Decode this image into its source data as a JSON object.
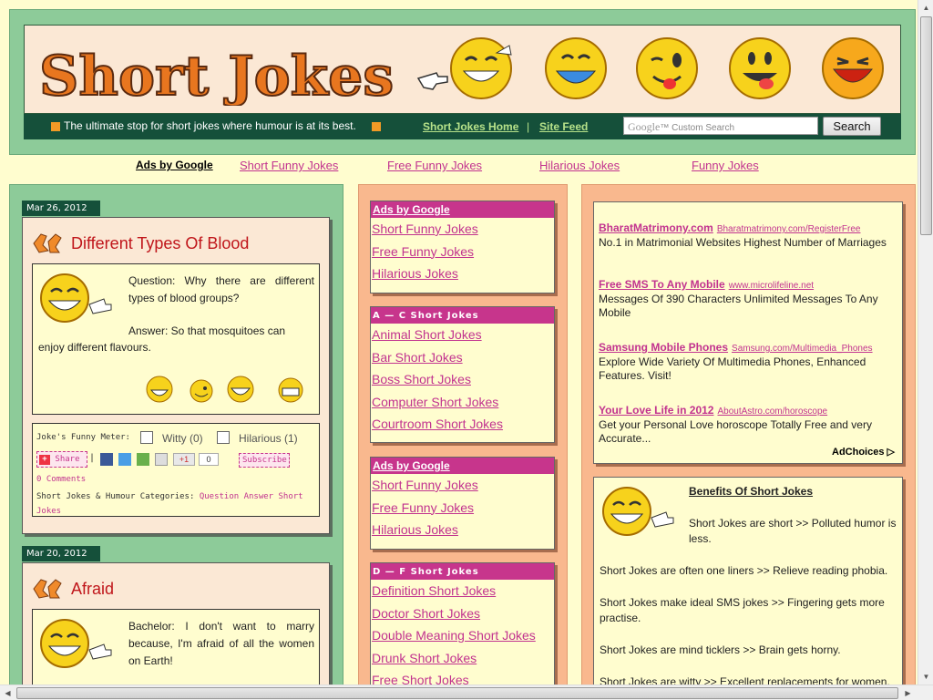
{
  "header": {
    "logo_text": "Short Jokes",
    "tagline": "The ultimate stop for short jokes where humour is at its best.",
    "nav_home": "Short Jokes Home",
    "nav_sep": "|",
    "nav_feed": "Site Feed",
    "search_google": "Google",
    "search_placeholder": "Custom Search",
    "search_button": "Search"
  },
  "ad_row": {
    "label": "Ads by Google",
    "links": [
      "Short Funny Jokes",
      "Free Funny Jokes",
      "Hilarious Jokes",
      "Funny Jokes"
    ]
  },
  "posts": [
    {
      "date": "Mar 26, 2012",
      "title": "Different Types Of Blood",
      "question": "Question: Why there are different types of blood groups?",
      "answer_1": "Answer: So that mosquitoes can",
      "answer_2": "enjoy different flavours.",
      "meter_label": "Joke's Funny Meter:",
      "witty": "Witty (0)",
      "hilarious": "Hilarious (1)",
      "share": "Share",
      "plus_one": "+1",
      "plus_count": "0",
      "subscribe": "Subscribe",
      "comments": "0 Comments",
      "categories_label": "Short Jokes & Humour Categories:",
      "categories": "Question Answer Short Jokes"
    },
    {
      "date": "Mar 20, 2012",
      "title": "Afraid",
      "text": "Bachelor: I don't want to marry because, I'm afraid of all the women on Earth!"
    }
  ],
  "sidebar": {
    "boxes": [
      {
        "header": "Ads by Google",
        "links": [
          "Short Funny Jokes",
          "Free Funny Jokes",
          "Hilarious Jokes"
        ]
      },
      {
        "header": "A — C Short Jokes",
        "links": [
          "Animal Short Jokes",
          "Bar Short Jokes",
          "Boss Short Jokes",
          "Computer Short Jokes",
          "Courtroom Short Jokes"
        ]
      },
      {
        "header": "Ads by Google",
        "links": [
          "Short Funny Jokes",
          "Free Funny Jokes",
          "Hilarious Jokes"
        ]
      },
      {
        "header": "D — F Short Jokes",
        "links": [
          "Definition Short Jokes",
          "Doctor Short Jokes",
          "Double Meaning Short Jokes",
          "Drunk Short Jokes",
          "Free Short Jokes"
        ]
      }
    ]
  },
  "ads": [
    {
      "title": "BharatMatrimony.com",
      "url": "Bharatmatrimony.com/RegisterFree",
      "desc": "No.1 in Matrimonial Websites Highest Number of Marriages"
    },
    {
      "title": "Free SMS To Any Mobile",
      "url": "www.microlifeline.net",
      "desc": "Messages Of 390 Characters Unlimited Messages To Any Mobile"
    },
    {
      "title": "Samsung Mobile Phones",
      "url": "Samsung.com/Multimedia_Phones",
      "desc": "Explore Wide Variety Of Multimedia Phones, Enhanced Features. Visit!"
    },
    {
      "title": "Your Love Life in 2012",
      "url": "AboutAstro.com/horoscope",
      "desc": "Get your Personal Love horoscope Totally Free and very Accurate..."
    }
  ],
  "adchoices": "AdChoices",
  "benefits": {
    "title": "Benefits Of Short Jokes",
    "intro": "Short Jokes are short >> Polluted humor is less.",
    "items": [
      "Short Jokes are often one liners >> Relieve reading phobia.",
      "Short Jokes make ideal SMS jokes >> Fingering gets more practise.",
      "Short Jokes are mind ticklers >> Brain gets horny.",
      "Short Jokes are witty >> Excellent replacements for women."
    ]
  },
  "colors": {
    "accent": "#c7358c",
    "green": "#8dcb99",
    "dark_green": "#15503a",
    "peach": "#f9b88e",
    "cream": "#fffdcf",
    "title_red": "#c0161b"
  },
  "icons": [
    "laughing-face-icon",
    "pointing-hand-icon",
    "wink-face-icon",
    "tongue-face-icon",
    "smile-face-icon"
  ]
}
